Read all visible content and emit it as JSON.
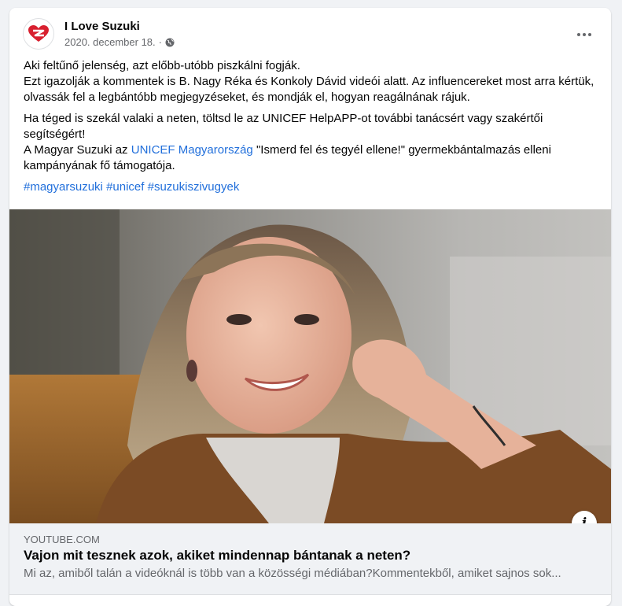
{
  "post": {
    "page_name": "I Love Suzuki",
    "date": "2020. december 18.",
    "separator": "·",
    "audience_icon": "globe-icon",
    "more_icon": "more-options-icon",
    "paragraphs": [
      "Aki feltűnő jelenség, azt előbb-utóbb piszkálni fogják.",
      "Ezt igazolják a kommentek is B. Nagy Réka és Konkoly Dávid videói alatt. Az influencereket most arra kértük, olvassák fel a legbántóbb megjegyzéseket, és mondják el, hogyan reagálnának rájuk.",
      "Ha téged is szekál valaki a neten, töltsd le az UNICEF HelpAPP-ot további tanácsért vagy szakértői segítségért!"
    ],
    "para4": {
      "before": "A Magyar Suzuki az ",
      "link": "UNICEF Magyarország",
      "after": " \"Ismerd fel és tegyél ellene!\" gyermekbántalmazás elleni kampányának fő támogatója."
    },
    "hashtags": [
      "#magyarsuzuki",
      "#unicef",
      "#suzukiszivugyek"
    ]
  },
  "link_preview": {
    "domain": "YOUTUBE.COM",
    "title": "Vajon mit tesznek azok, akiket mindennap bántanak a neten?",
    "description": "Mi az, amiből talán a videóknál is több van a közösségi médiában?Kommentekből, amiket sajnos sok...",
    "info_label": "i"
  },
  "colors": {
    "link": "#216fdb",
    "secondary_text": "#65676b",
    "brand_red": "#d8202f"
  }
}
